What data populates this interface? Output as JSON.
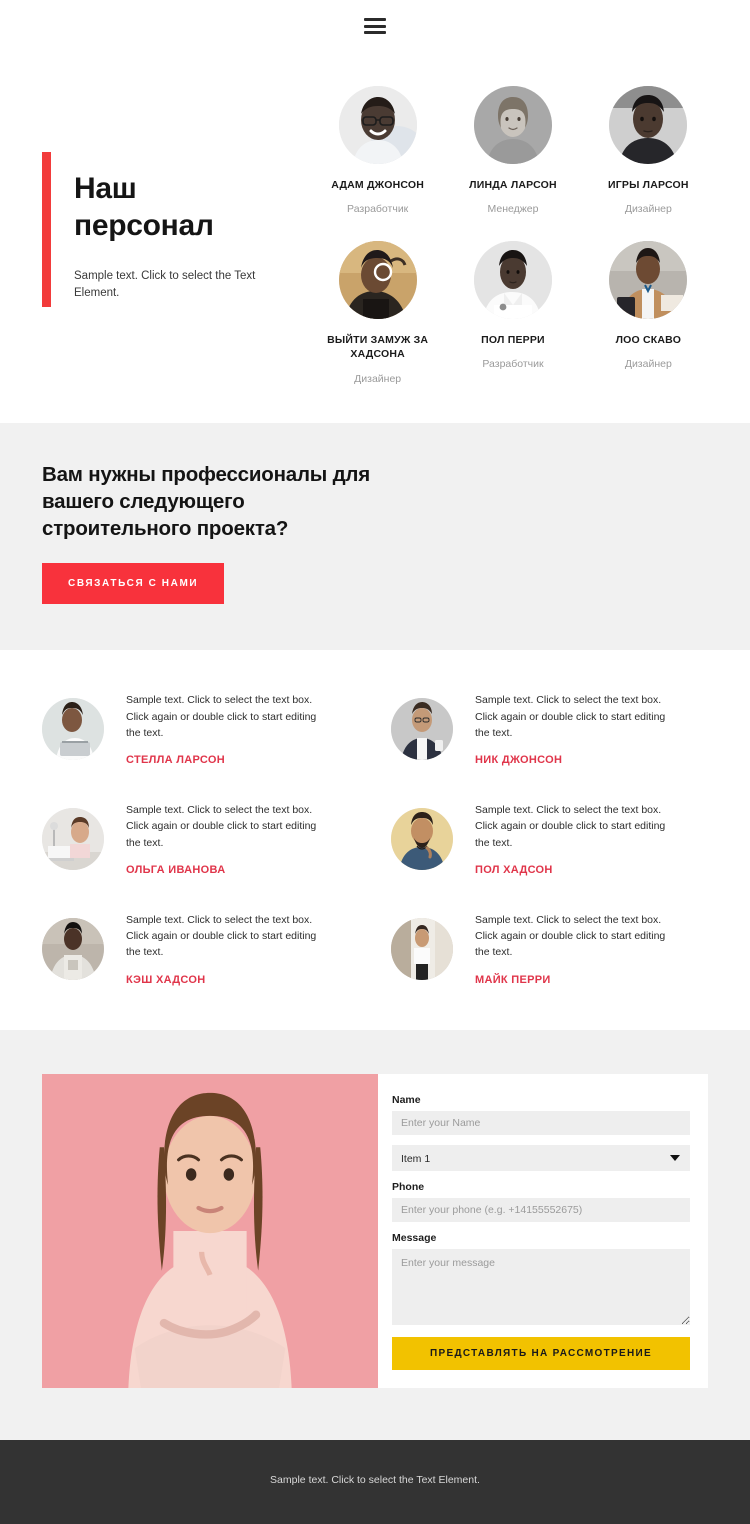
{
  "header": {
    "menu_icon": "hamburger-menu-icon"
  },
  "hero": {
    "title": "Наш\nперсонал",
    "subtitle": "Sample text. Click to select the Text Element.",
    "accent_color": "#f23b3b"
  },
  "team": [
    {
      "name": "АДАМ ДЖОНСОН",
      "role": "Разработчик",
      "avatar": "portrait-man-glasses"
    },
    {
      "name": "ЛИНДА ЛАРСОН",
      "role": "Менеджер",
      "avatar": "portrait-woman-sweater"
    },
    {
      "name": "ИГРЫ ЛАРСОН",
      "role": "Дизайнер",
      "avatar": "portrait-young-man"
    },
    {
      "name": "ВЫЙТИ ЗАМУЖ ЗА ХАДСОНА",
      "role": "Дизайнер",
      "avatar": "portrait-woman-braids"
    },
    {
      "name": "ПОЛ ПЕРРИ",
      "role": "Разработчик",
      "avatar": "portrait-man-shirt"
    },
    {
      "name": "ЛОО СКАВО",
      "role": "Дизайнер",
      "avatar": "portrait-woman-blazer"
    }
  ],
  "cta": {
    "title": "Вам нужны профессионалы для\nвашего следующего\nстроительного проекта?",
    "button_label": "СВЯЗАТЬСЯ С НАМИ",
    "button_color": "#f8323c",
    "background": "#f1f1f1"
  },
  "people": [
    {
      "text": "Sample text. Click to select the text box. Click again or double click to start editing the text.",
      "name": "СТЕЛЛА ЛАРСОН",
      "photo": "woman-with-laptop"
    },
    {
      "text": "Sample text. Click to select the text box. Click again or double click to start editing the text.",
      "name": "НИК ДЖОНСОН",
      "photo": "man-in-suit-coffee"
    },
    {
      "text": "Sample text. Click to select the text box. Click again or double click to start editing the text.",
      "name": "ОЛЬГА ИВАНОВА",
      "photo": "woman-at-desk"
    },
    {
      "text": "Sample text. Click to select the text box. Click again or double click to start editing the text.",
      "name": "ПОЛ ХАДСОН",
      "photo": "bearded-man-denim"
    },
    {
      "text": "Sample text. Click to select the text box. Click again or double click to start editing the text.",
      "name": "КЭШ ХАДСОН",
      "photo": "man-in-hoodie"
    },
    {
      "text": "Sample text. Click to select the text box. Click again or double click to start editing the text.",
      "name": "МАЙК ПЕРРИ",
      "photo": "man-by-window"
    }
  ],
  "people_name_color": "#e0354a",
  "contact": {
    "photo": "woman-pink-background",
    "name_label": "Name",
    "name_placeholder": "Enter your Name",
    "select_value": "Item 1",
    "select_options": [
      "Item 1"
    ],
    "phone_label": "Phone",
    "phone_placeholder": "Enter your phone (e.g. +14155552675)",
    "message_label": "Message",
    "message_placeholder": "Enter your message",
    "submit_label": "ПРЕДСТАВЛЯТЬ НА РАССМОТРЕНИЕ",
    "submit_color": "#f2c200"
  },
  "footer": {
    "text": "Sample text. Click to select the Text Element.",
    "background": "#333333"
  }
}
